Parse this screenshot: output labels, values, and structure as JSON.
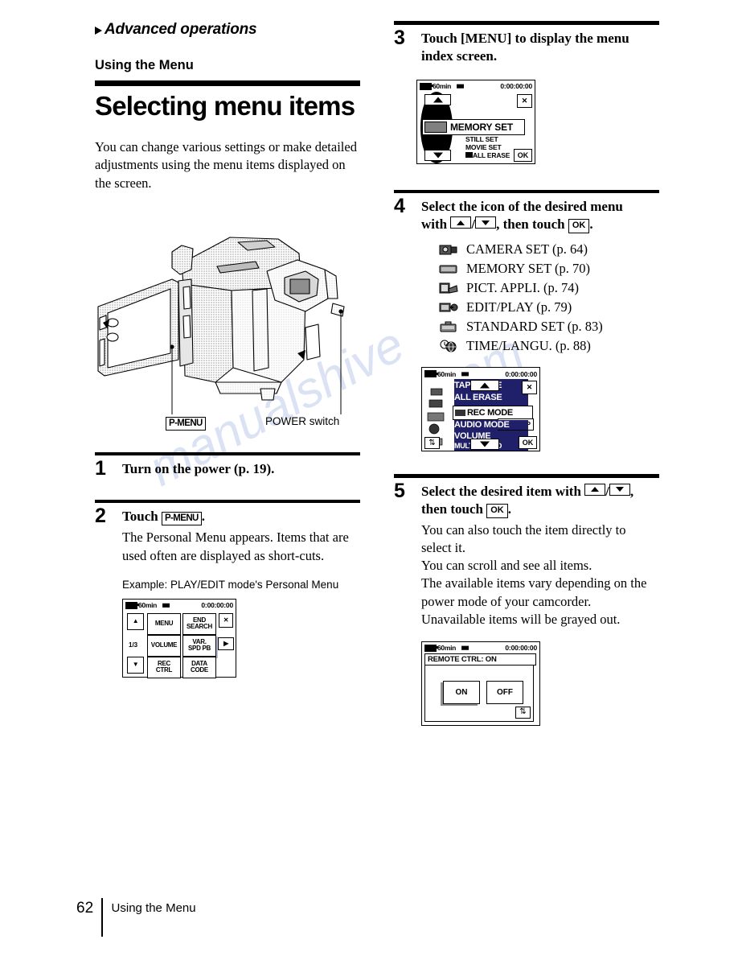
{
  "header": {
    "chapter": "Advanced operations",
    "section": "Using the Menu",
    "title": "Selecting menu items",
    "intro": "You can change various settings or make detailed adjustments using the menu items displayed on the screen."
  },
  "illustration": {
    "callout_pmenu": "P-MENU",
    "callout_power": "POWER switch"
  },
  "steps": {
    "step1": {
      "number": "1",
      "heading": "Turn on the power (p. 19)."
    },
    "step2": {
      "number": "2",
      "heading_prefix": "Touch",
      "heading_chip": "P-MENU",
      "heading_suffix": ".",
      "body": "The Personal Menu appears. Items that are used often are displayed as short-cuts.",
      "caption": "Example: PLAY/EDIT mode's Personal Menu"
    },
    "step3": {
      "number": "3",
      "heading": "Touch [MENU] to display the menu index screen."
    },
    "step4": {
      "number": "4",
      "heading_a": "Select the icon of the desired menu",
      "heading_b_prefix": "with",
      "heading_b_sep": "/",
      "heading_b_mid": ", then touch",
      "heading_b_chip": "OK",
      "heading_b_suffix": ".",
      "menu_items": [
        {
          "icon": "camera-set-icon",
          "label": "CAMERA SET (p. 64)"
        },
        {
          "icon": "memory-set-icon",
          "label": "MEMORY SET (p. 70)"
        },
        {
          "icon": "pict-appli-icon",
          "label": "PICT. APPLI. (p. 74)"
        },
        {
          "icon": "edit-play-icon",
          "label": "EDIT/PLAY (p. 79)"
        },
        {
          "icon": "standard-set-icon",
          "label": "STANDARD SET (p. 83)"
        },
        {
          "icon": "time-langu-icon",
          "label": "TIME/LANGU. (p. 88)"
        }
      ]
    },
    "step5": {
      "number": "5",
      "heading_prefix": "Select the desired item with",
      "heading_sep": "/",
      "heading_mid": ",",
      "heading_then": "then touch",
      "heading_chip": "OK",
      "heading_suffix": ".",
      "body_lines": [
        "You can also touch the item directly to",
        "select it.",
        "You can scroll and see all items.",
        "The available items vary depending on the",
        "power mode of your camcorder.",
        "Unavailable items will be grayed out."
      ]
    }
  },
  "lcd_personal_menu": {
    "status": {
      "battery": "60min",
      "timecode": "0:00:00:00"
    },
    "page_indicator": "1/3",
    "scroll_up": "scroll-up-icon",
    "scroll_down": "scroll-down-icon",
    "close": "close-icon",
    "play": "play-icon",
    "buttons": [
      {
        "label": "MENU"
      },
      {
        "label": "END SEARCH"
      },
      {
        "label": "VOLUME"
      },
      {
        "label": "VAR. SPD PB"
      },
      {
        "label": "REC CTRL"
      },
      {
        "label": "DATA CODE"
      }
    ]
  },
  "lcd_menu_index": {
    "status": {
      "battery": "60min",
      "timecode": "0:00:00:00"
    },
    "selected": "MEMORY SET",
    "sub_items": [
      "STILL SET",
      "MOVIE SET",
      "ALL ERASE"
    ],
    "ok_label": "OK",
    "close": "close-icon",
    "arrow_up": "arrow-up-icon",
    "arrow_down": "arrow-down-icon"
  },
  "lcd_scroll_list": {
    "status": {
      "battery": "60min",
      "timecode": "0:00:00:00"
    },
    "items_above": [
      "TAPE TITLE",
      "ALL ERASE"
    ],
    "selected": "REC MODE",
    "selected_value": "SP",
    "items_below": [
      "AUDIO MODE",
      "VOLUME",
      "MULTI-SOUND"
    ],
    "ok_label": "OK",
    "close": "close-icon",
    "return": "return-icon"
  },
  "lcd_remote_ctrl": {
    "status": {
      "battery": "60min",
      "timecode": "0:00:00:00"
    },
    "title": "REMOTE CTRL:  ON",
    "option_on": "ON",
    "option_off": "OFF",
    "return": "return-icon"
  },
  "footer": {
    "page_number": "62",
    "running_head": "Using the Menu"
  },
  "watermark": {
    "line1": "manualshive",
    "line2": ".com"
  }
}
